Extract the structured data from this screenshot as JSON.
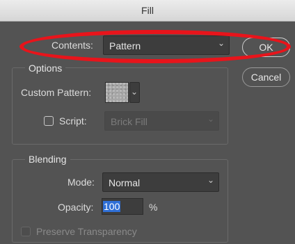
{
  "window": {
    "title": "Fill"
  },
  "contents": {
    "label": "Contents:",
    "value": "Pattern"
  },
  "buttons": {
    "ok": "OK",
    "cancel": "Cancel"
  },
  "options": {
    "legend": "Options",
    "custom_pattern_label": "Custom Pattern:",
    "script_label": "Script:",
    "script_value": "Brick Fill"
  },
  "blending": {
    "legend": "Blending",
    "mode_label": "Mode:",
    "mode_value": "Normal",
    "opacity_label": "Opacity:",
    "opacity_value": "100",
    "opacity_unit": "%",
    "preserve_label": "Preserve Transparency"
  },
  "icons": {
    "dropdown": "chevron-down-icon"
  },
  "colors": {
    "annotation": "#e8141b",
    "selection": "#2f6fd6"
  }
}
